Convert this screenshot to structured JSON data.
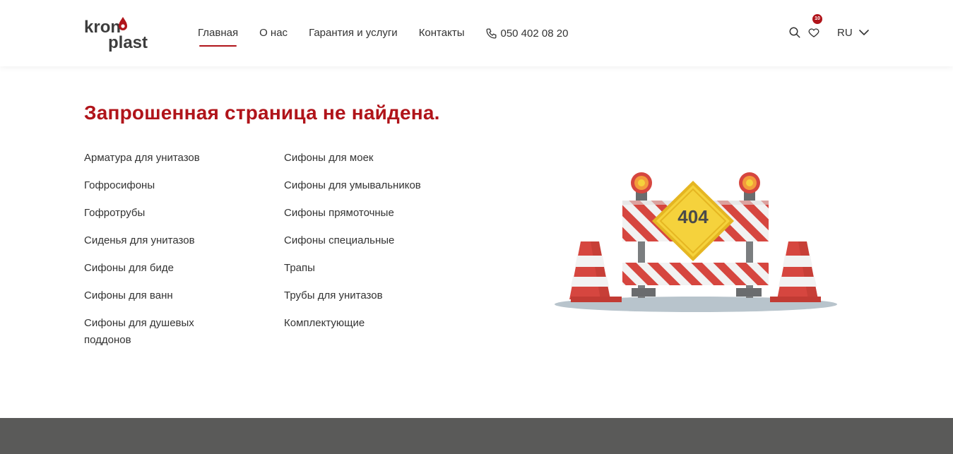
{
  "header": {
    "logo_text_top": "kron",
    "logo_text_bottom": "plast",
    "nav": [
      {
        "label": "Главная",
        "active": true
      },
      {
        "label": "О нас",
        "active": false
      },
      {
        "label": "Гарантия и услуги",
        "active": false
      },
      {
        "label": "Контакты",
        "active": false
      }
    ],
    "phone": "050 402 08 20",
    "favorites_count": "10",
    "language": "RU",
    "icons": [
      "phone-icon",
      "search-icon",
      "heart-icon",
      "chevron-down-icon"
    ]
  },
  "main": {
    "title": "Запрошенная страница не найдена.",
    "column1": [
      "Арматура для унитазов",
      "Гофросифоны",
      "Гофротрубы",
      "Сиденья для унитазов",
      "Сифоны для биде",
      "Сифоны для ванн",
      "Сифоны для душевых поддонов"
    ],
    "column2": [
      "Сифоны для моек",
      "Сифоны для умывальников",
      "Сифоны прямоточные",
      "Сифоны специальные",
      "Трапы",
      "Трубы для унитазов",
      "Комплектующие"
    ],
    "illustration_text": "404"
  },
  "colors": {
    "brand_red": "#b0141a",
    "text": "#333333",
    "footer": "#5a5a59",
    "sign_yellow": "#f5d23c",
    "cone_red": "#d6463f"
  }
}
